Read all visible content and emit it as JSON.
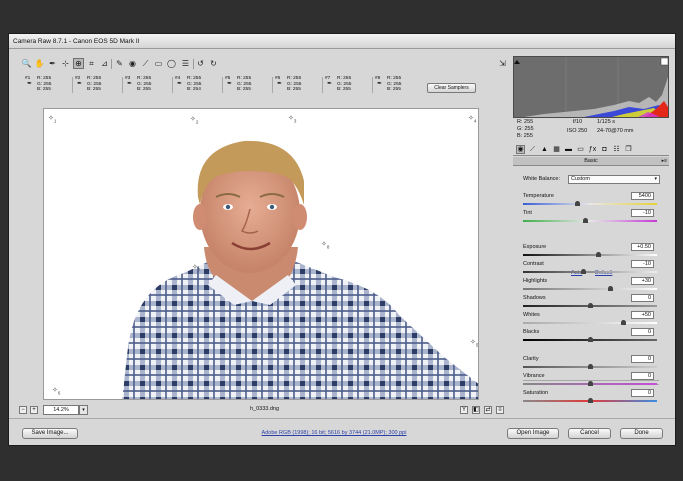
{
  "window": {
    "title": "Camera Raw 8.7.1  -  Canon EOS 5D Mark II"
  },
  "toolbar": {
    "tools": [
      "zoom-icon",
      "hand-icon",
      "white-balance-icon",
      "color-sampler-icon",
      "targeted-adjustment-icon",
      "crop-icon",
      "straighten-icon",
      "spot-removal-icon",
      "red-eye-icon",
      "adjustment-brush-icon",
      "graduated-filter-icon",
      "radial-filter-icon",
      "preferences-icon",
      "rotate-ccw-icon",
      "rotate-cw-icon"
    ],
    "glyphs": [
      "🔍",
      "✋",
      "✒",
      "⊹",
      "⊕",
      "⌗",
      "⊿",
      "✎",
      "◉",
      "⟋",
      "▭",
      "◯",
      "☰",
      "↺",
      "↻"
    ],
    "right_icon": "⇲"
  },
  "samplers": [
    {
      "num": "#1",
      "r": "R: 255",
      "g": "G: 255",
      "b": "B: 255"
    },
    {
      "num": "#2",
      "r": "R: 255",
      "g": "G: 255",
      "b": "B: 255"
    },
    {
      "num": "#3",
      "r": "R: 255",
      "g": "G: 255",
      "b": "B: 255"
    },
    {
      "num": "#4",
      "r": "R: 255",
      "g": "G: 255",
      "b": "B: 254"
    },
    {
      "num": "#5",
      "r": "R: 255",
      "g": "G: 255",
      "b": "B: 255"
    },
    {
      "num": "#6",
      "r": "R: 255",
      "g": "G: 255",
      "b": "B: 255"
    },
    {
      "num": "#7",
      "r": "R: 255",
      "g": "G: 255",
      "b": "B: 255"
    },
    {
      "num": "#8",
      "r": "R: 255",
      "g": "G: 255",
      "b": "B: 255"
    }
  ],
  "clear_samplers_label": "Clear Samplers",
  "sampler_points": [
    "1",
    "2",
    "3",
    "4",
    "5",
    "6",
    "7",
    "8"
  ],
  "zoom": {
    "value": "14.2%"
  },
  "file": {
    "name": "h_0333.dng"
  },
  "camera_info": {
    "r": "R:  255",
    "g": "G:  255",
    "b": "B:  255",
    "aperture": "f/10",
    "shutter": "1/125 s",
    "iso": "ISO 250",
    "lens": "24-70@70 mm"
  },
  "panel": {
    "title": "Basic",
    "white_balance_label": "White Balance:",
    "white_balance_value": "Custom",
    "auto_label": "Auto",
    "default_label": "Default",
    "sliders": [
      {
        "label": "Temperature",
        "value": "5400",
        "pos": 0.41
      },
      {
        "label": "Tint",
        "value": "-10",
        "pos": 0.47
      },
      {
        "label": "Exposure",
        "value": "+0.50",
        "pos": 0.56
      },
      {
        "label": "Contrast",
        "value": "-10",
        "pos": 0.45
      },
      {
        "label": "Highlights",
        "value": "+30",
        "pos": 0.65
      },
      {
        "label": "Shadows",
        "value": "0",
        "pos": 0.5
      },
      {
        "label": "Whites",
        "value": "+50",
        "pos": 0.75
      },
      {
        "label": "Blacks",
        "value": "0",
        "pos": 0.5
      },
      {
        "label": "Clarity",
        "value": "0",
        "pos": 0.5
      },
      {
        "label": "Vibrance",
        "value": "0",
        "pos": 0.5
      },
      {
        "label": "Saturation",
        "value": "0",
        "pos": 0.5
      }
    ]
  },
  "footer": {
    "save_label": "Save Image...",
    "workflow_link": "Adobe RGB (1998); 16 bit; 5616 by 3744 (21.0MP); 300 ppi",
    "open_label": "Open Image",
    "cancel_label": "Cancel",
    "done_label": "Done"
  }
}
